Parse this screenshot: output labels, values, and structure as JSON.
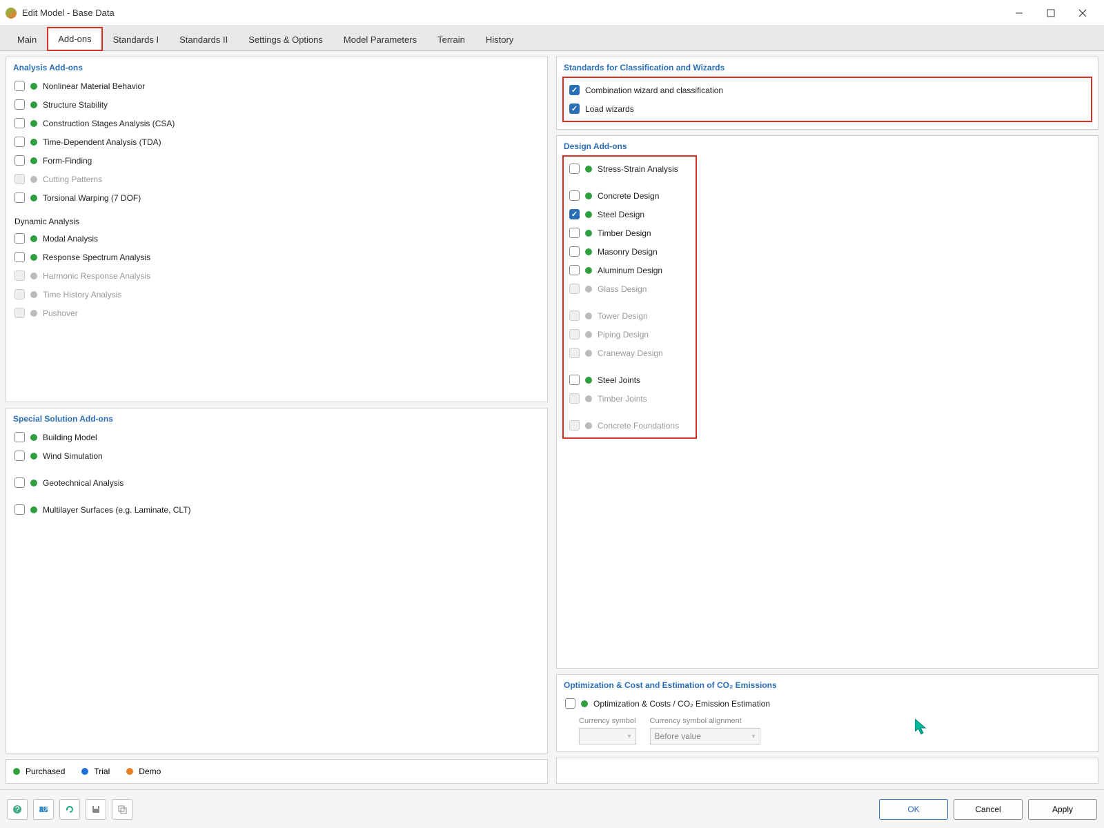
{
  "window": {
    "title": "Edit Model - Base Data"
  },
  "tabs": {
    "main": "Main",
    "addons": "Add-ons",
    "std1": "Standards I",
    "std2": "Standards II",
    "settings": "Settings & Options",
    "params": "Model Parameters",
    "terrain": "Terrain",
    "history": "History"
  },
  "analysis": {
    "title": "Analysis Add-ons",
    "nonlinear": "Nonlinear Material Behavior",
    "stability": "Structure Stability",
    "csa": "Construction Stages Analysis (CSA)",
    "tda": "Time-Dependent Analysis (TDA)",
    "form": "Form-Finding",
    "cutting": "Cutting Patterns",
    "torsional": "Torsional Warping (7 DOF)",
    "dynamic_sub": "Dynamic Analysis",
    "modal": "Modal Analysis",
    "response": "Response Spectrum Analysis",
    "harmonic": "Harmonic Response Analysis",
    "timehist": "Time History Analysis",
    "pushover": "Pushover"
  },
  "special": {
    "title": "Special Solution Add-ons",
    "building": "Building Model",
    "wind": "Wind Simulation",
    "geo": "Geotechnical Analysis",
    "multilayer": "Multilayer Surfaces (e.g. Laminate, CLT)"
  },
  "standards": {
    "title": "Standards for Classification and Wizards",
    "combo": "Combination wizard and classification",
    "load": "Load wizards"
  },
  "design": {
    "title": "Design Add-ons",
    "stress": "Stress-Strain Analysis",
    "concrete": "Concrete Design",
    "steel": "Steel Design",
    "timber": "Timber Design",
    "masonry": "Masonry Design",
    "aluminum": "Aluminum Design",
    "glass": "Glass Design",
    "tower": "Tower Design",
    "piping": "Piping Design",
    "craneway": "Craneway Design",
    "steeljoints": "Steel Joints",
    "timberjoints": "Timber Joints",
    "foundations": "Concrete Foundations"
  },
  "optimization": {
    "title": "Optimization & Cost and Estimation of CO₂ Emissions",
    "opt_label": "Optimization & Costs / CO₂ Emission Estimation",
    "currency_label": "Currency symbol",
    "align_label": "Currency symbol alignment",
    "currency_value": "",
    "align_value": "Before value"
  },
  "legend": {
    "purchased": "Purchased",
    "trial": "Trial",
    "demo": "Demo"
  },
  "buttons": {
    "ok": "OK",
    "cancel": "Cancel",
    "apply": "Apply"
  }
}
